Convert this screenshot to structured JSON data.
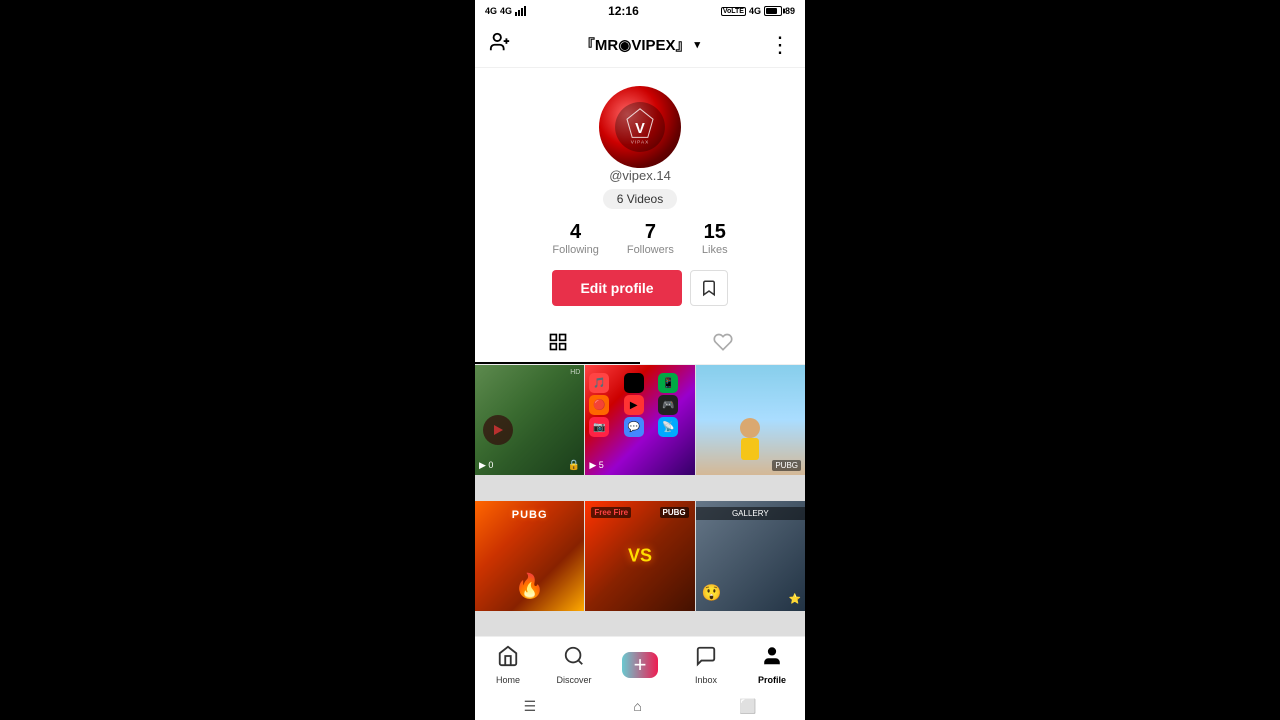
{
  "statusBar": {
    "time": "12:16",
    "battery": "89",
    "network": "4G"
  },
  "topNav": {
    "addUserIcon": "person-add",
    "title": "『MR◉VIPEX』",
    "moreIcon": "⋮",
    "dropdownIcon": "▾"
  },
  "profile": {
    "username": "@vipex.14",
    "videosBadge": "6 Videos",
    "stats": {
      "following": {
        "count": "4",
        "label": "Following"
      },
      "followers": {
        "count": "7",
        "label": "Followers"
      },
      "likes": {
        "count": "15",
        "label": "Likes"
      }
    },
    "editProfileBtn": "Edit profile",
    "bookmarkBtn": "🔖"
  },
  "tabs": {
    "grid": "☰☰☰",
    "liked": "♡"
  },
  "videos": [
    {
      "id": 1,
      "type": "pubg-gameplay",
      "playCount": "",
      "locked": true
    },
    {
      "id": 2,
      "type": "app-screen",
      "playCount": "5",
      "locked": false
    },
    {
      "id": 3,
      "type": "person",
      "playCount": "",
      "locked": false
    },
    {
      "id": 4,
      "type": "pubg-fire",
      "playCount": "",
      "locked": false
    },
    {
      "id": 5,
      "type": "vs-screen",
      "playCount": "",
      "locked": false
    },
    {
      "id": 6,
      "type": "gallery",
      "playCount": "",
      "locked": false
    }
  ],
  "bottomNav": {
    "items": [
      {
        "id": "home",
        "icon": "⌂",
        "label": "Home",
        "active": false
      },
      {
        "id": "discover",
        "icon": "⊙",
        "label": "Discover",
        "active": false
      },
      {
        "id": "add",
        "icon": "+",
        "label": "",
        "active": false
      },
      {
        "id": "inbox",
        "icon": "💬",
        "label": "Inbox",
        "active": false
      },
      {
        "id": "profile",
        "icon": "👤",
        "label": "Profile",
        "active": true
      }
    ]
  },
  "androidNav": {
    "menu": "☰",
    "home": "⌂",
    "back": "⬜"
  }
}
